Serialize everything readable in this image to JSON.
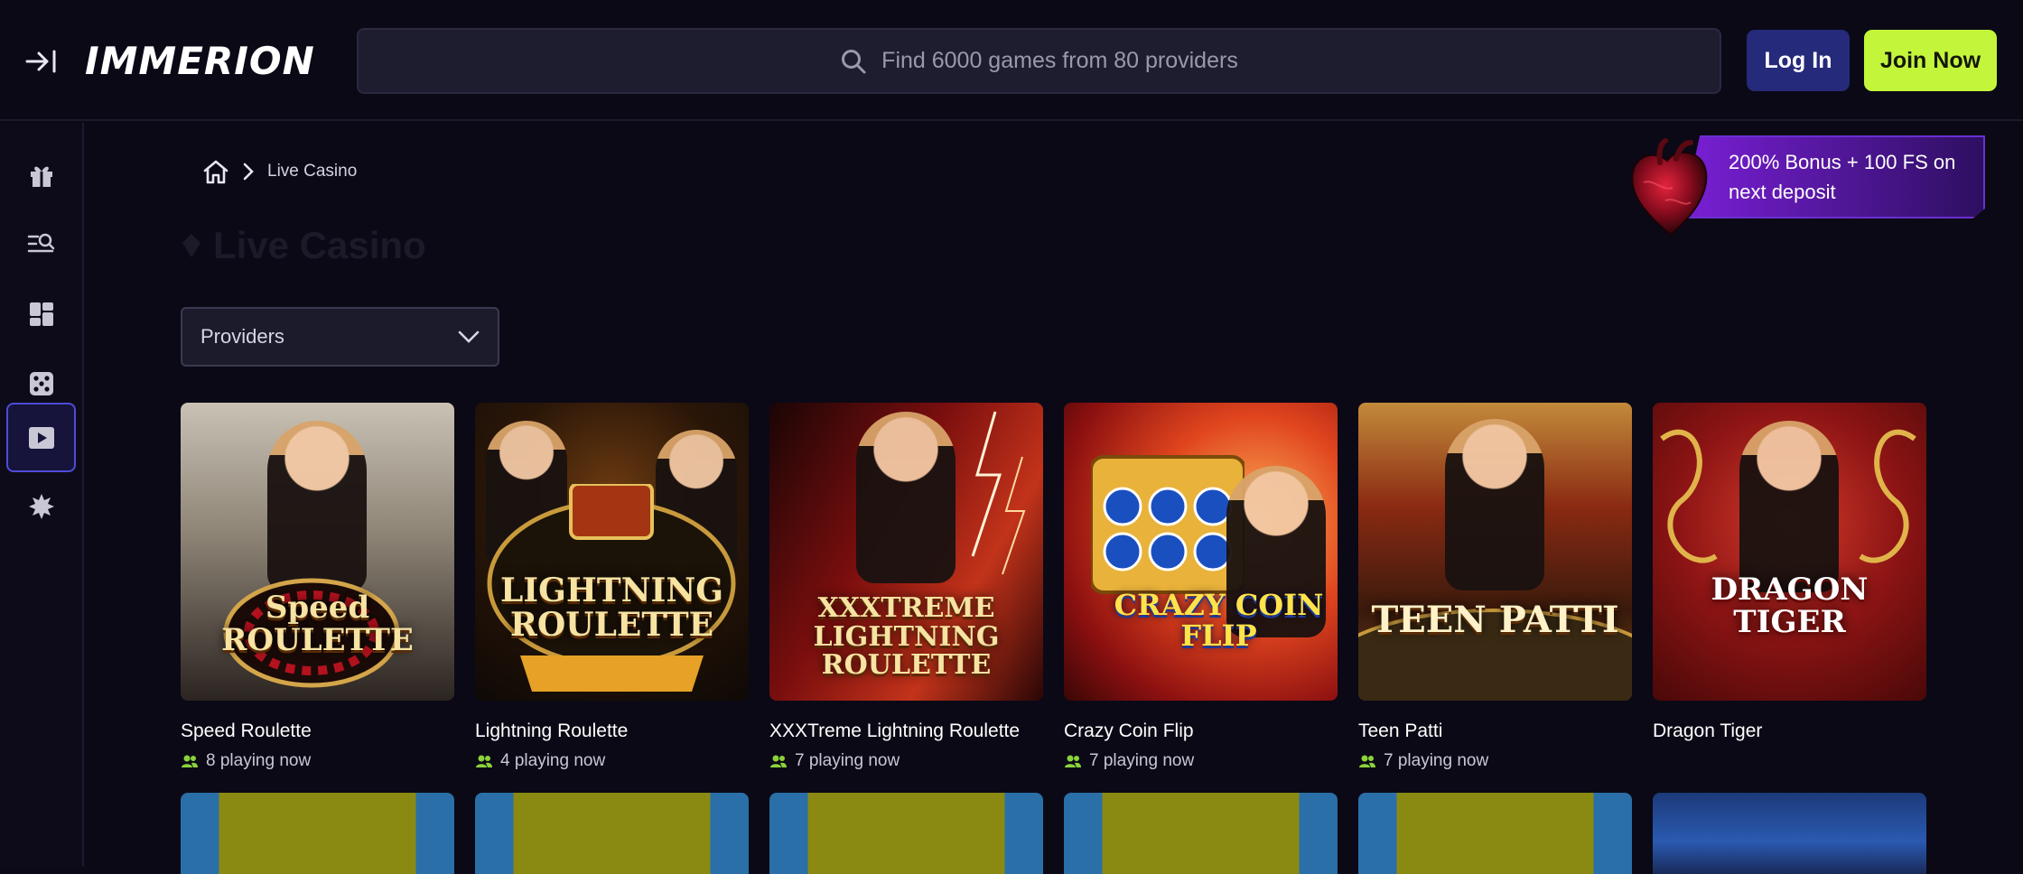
{
  "header": {
    "logo": "IMMERION",
    "search_placeholder": "Find 6000 games from 80 providers",
    "login_label": "Log In",
    "join_label": "Join Now"
  },
  "sidebar": {
    "items": [
      {
        "icon": "gift-icon"
      },
      {
        "icon": "search-list-icon"
      },
      {
        "icon": "dashboard-icon"
      },
      {
        "icon": "dice-icon"
      },
      {
        "icon": "live-play-icon",
        "active": true
      },
      {
        "icon": "starburst-icon"
      }
    ]
  },
  "breadcrumb": {
    "current": "Live Casino"
  },
  "page": {
    "title": "Live Casino"
  },
  "bonus": {
    "line1": "200% Bonus + 100 FS on",
    "line2": "next deposit"
  },
  "filters": {
    "providers_label": "Providers"
  },
  "games": [
    {
      "name": "Speed Roulette",
      "players": "8 playing now",
      "thumb_title": "Speed ROULETTE"
    },
    {
      "name": "Lightning Roulette",
      "players": "4 playing now",
      "thumb_title": "LIGHTNING ROULETTE"
    },
    {
      "name": "XXXTreme Lightning Roulette",
      "players": "7 playing now",
      "thumb_title": "XXXTREME LIGHTNING ROULETTE"
    },
    {
      "name": "Crazy Coin Flip",
      "players": "7 playing now",
      "thumb_title": "CRAZY COIN FLIP"
    },
    {
      "name": "Teen Patti",
      "players": "7 playing now",
      "thumb_title": "TEEN PATTI"
    },
    {
      "name": "Dragon Tiger",
      "players": "",
      "thumb_title": "DRAGON TIGER"
    }
  ],
  "colors": {
    "background": "#0b0916",
    "login": "#262a7a",
    "join": "#c3f53b",
    "bonus": "#7a1fd6",
    "active_nav": "#4f4bd8"
  }
}
